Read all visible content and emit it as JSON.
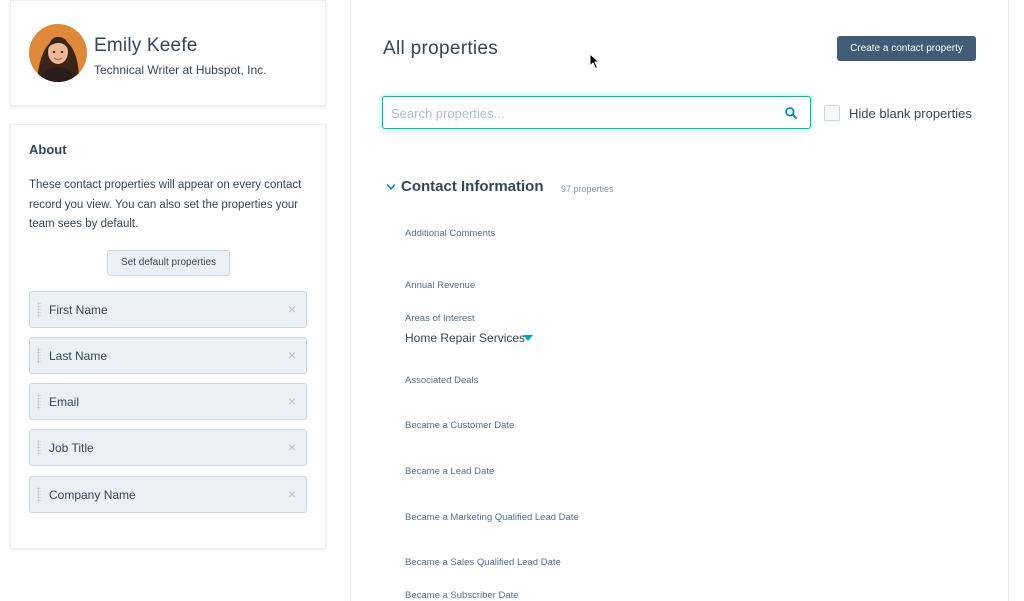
{
  "profile": {
    "name": "Emily Keefe",
    "title": "Technical Writer at Hubspot, Inc."
  },
  "about": {
    "heading": "About",
    "description": "These contact properties will appear on every contact record you view. You can also set the properties your team sees by default.",
    "default_button": "Set default properties",
    "properties": [
      {
        "label": "First Name"
      },
      {
        "label": "Last Name"
      },
      {
        "label": "Email"
      },
      {
        "label": "Job Title"
      },
      {
        "label": "Company Name"
      }
    ],
    "remove_glyph": "×"
  },
  "main": {
    "title": "All properties",
    "create_button": "Create a contact property",
    "search": {
      "placeholder": "Search properties...",
      "icon": "search-icon"
    },
    "hide_blank": {
      "label": "Hide blank properties",
      "checked": false
    },
    "section": {
      "title": "Contact Information",
      "count": "97 properties",
      "fields": [
        {
          "label": "Additional Comments"
        },
        {
          "label": "Annual Revenue"
        },
        {
          "label": "Areas of Interest",
          "value": "Home Repair Services"
        },
        {
          "label": "Associated Deals"
        },
        {
          "label": "Became a Customer Date"
        },
        {
          "label": "Became a Lead Date"
        },
        {
          "label": "Became a Marketing Qualified Lead Date"
        },
        {
          "label": "Became a Sales Qualified Lead Date"
        },
        {
          "label": "Became a Subscriber Date"
        }
      ]
    }
  },
  "colors": {
    "accent": "#00bda5",
    "primary_button": "#425b76",
    "text": "#33475b",
    "muted": "#516f90",
    "chip_bg": "#eaf0f6"
  }
}
